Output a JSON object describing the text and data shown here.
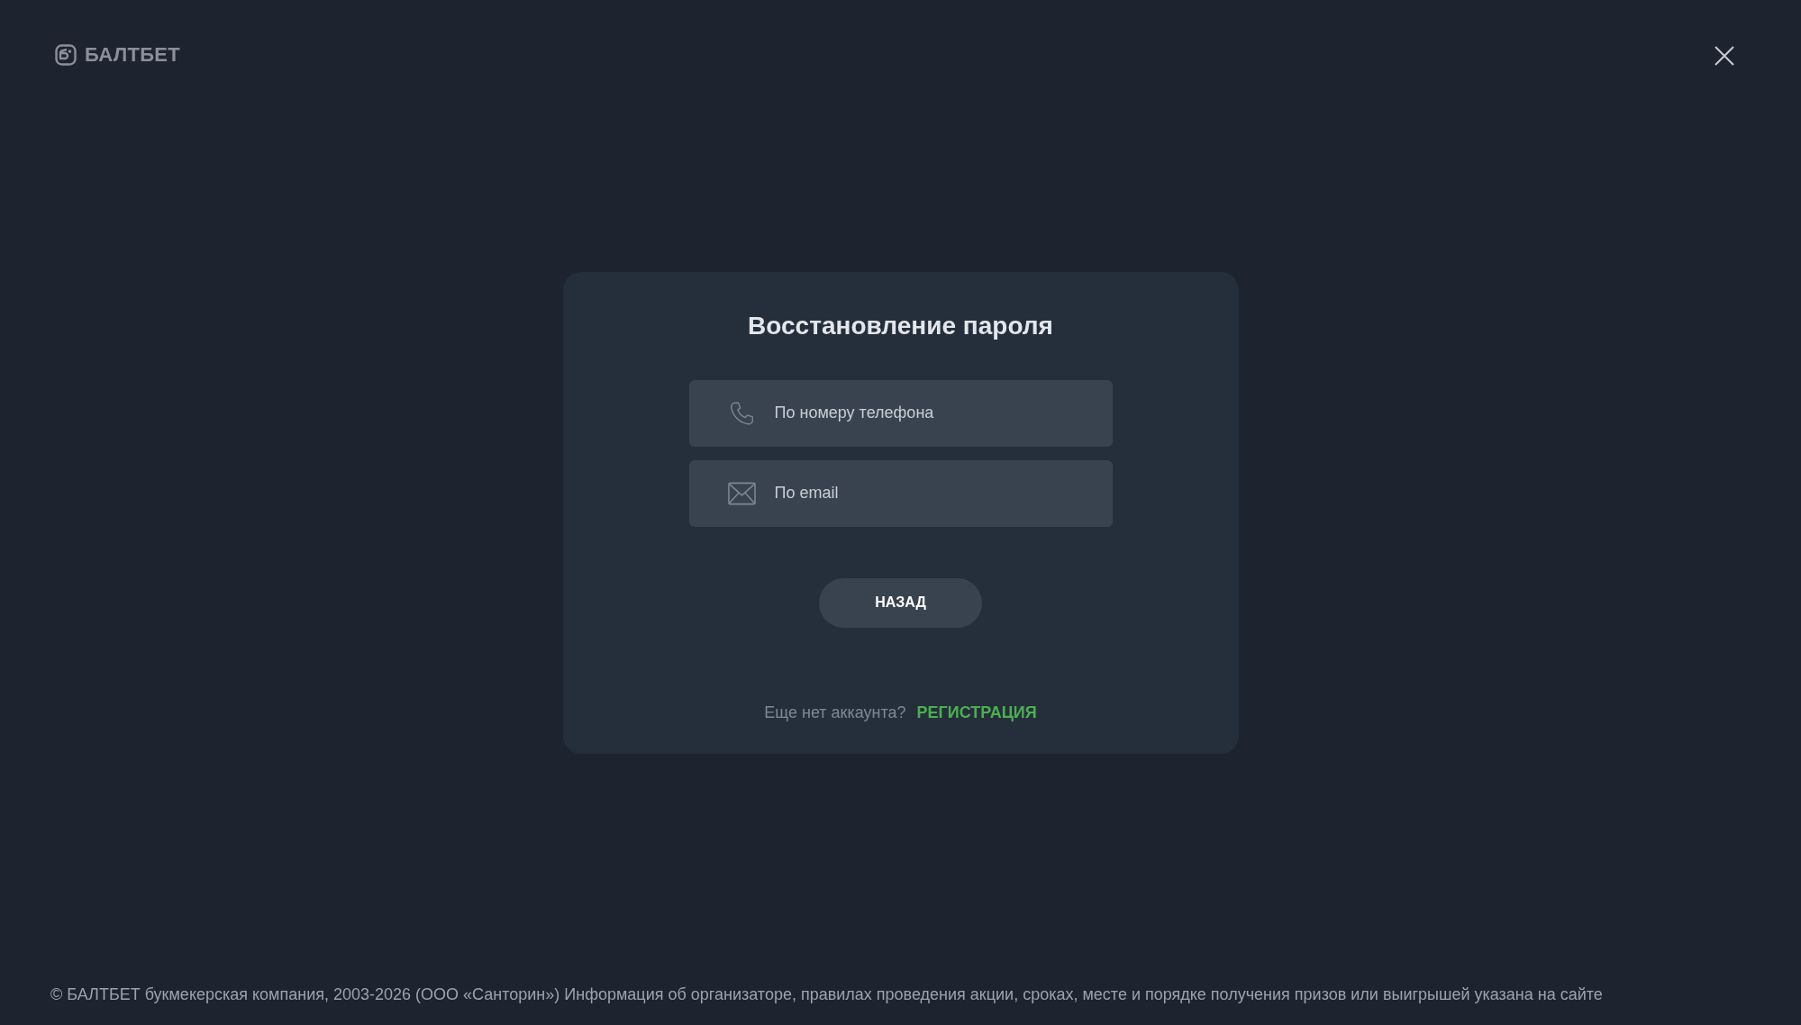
{
  "header": {
    "logo_text": "БАЛТБЕТ"
  },
  "dialog": {
    "title": "Восстановление пароля",
    "options": [
      {
        "kind": "phone",
        "label": "По номеру телефона"
      },
      {
        "kind": "email",
        "label": "По email"
      }
    ],
    "back_button": "НАЗАД",
    "signup_prompt": "Еще нет аккаунта?",
    "signup_link": "РЕГИСТРАЦИЯ"
  },
  "footer": {
    "text": "© БАЛТБЕТ букмекерская компания, 2003-2026 (ООО «Санторин») Информация об организаторе, правилах проведения акции, сроках, месте и порядке получения призов или выигрышей указана на сайте"
  }
}
